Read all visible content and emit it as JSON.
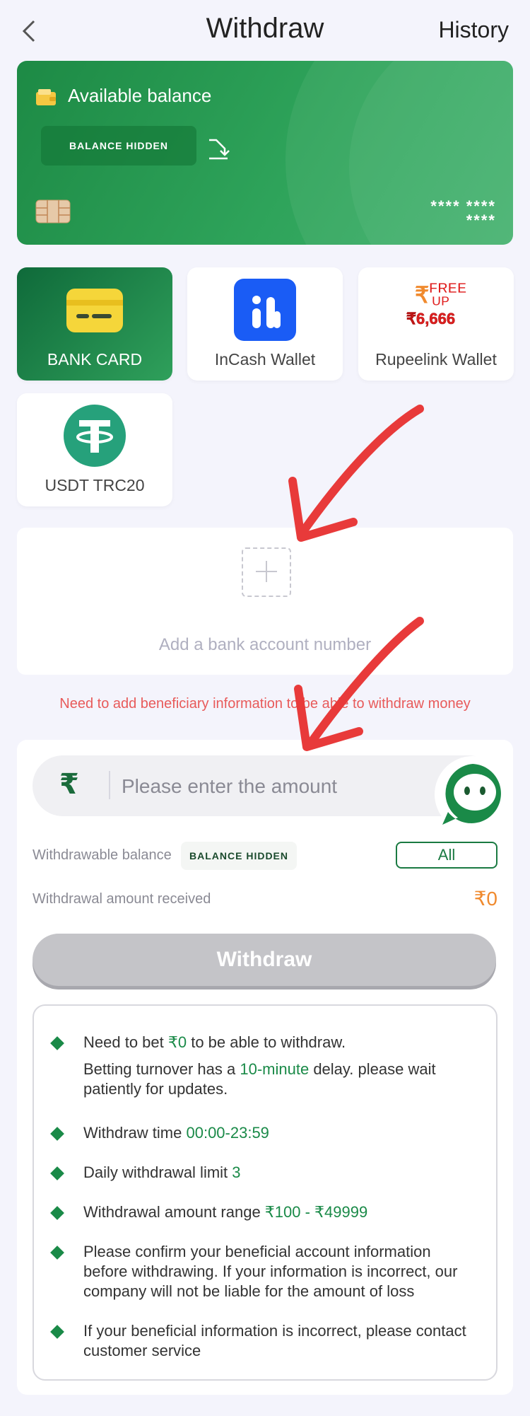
{
  "header": {
    "title": "Withdraw",
    "history_label": "History"
  },
  "balance_card": {
    "label": "Available balance",
    "balance_status": "BALANCE HIDDEN",
    "card_mask_line1": "**** ****",
    "card_mask_line2": "****"
  },
  "methods": [
    {
      "label": "BANK CARD",
      "active": true
    },
    {
      "label": "InCash Wallet",
      "active": false
    },
    {
      "label": "Rupeelink Wallet",
      "active": false,
      "promo_line1": "FREE",
      "promo_line2": "UP",
      "promo_amount": "₹6,666"
    },
    {
      "label": "USDT TRC20",
      "active": false
    }
  ],
  "add_account": {
    "label": "Add a bank account number"
  },
  "warning": {
    "text": "Need to add beneficiary information to be able to withdraw money"
  },
  "amount": {
    "currency_symbol": "₹",
    "placeholder": "Please enter the amount"
  },
  "withdrawable": {
    "label": "Withdrawable balance",
    "status": "BALANCE HIDDEN",
    "all_label": "All"
  },
  "received": {
    "label": "Withdrawal amount received",
    "value": "₹0"
  },
  "withdraw_button": {
    "label": "Withdraw"
  },
  "rules": {
    "r1_pre": "Need to bet ",
    "r1_hl": "₹0",
    "r1_post": " to be able to withdraw.",
    "r1b_pre": "Betting turnover has a ",
    "r1b_hl": "10-minute",
    "r1b_post": " delay. please wait patiently for updates.",
    "r2_pre": "Withdraw time ",
    "r2_hl": "00:00-23:59",
    "r3_pre": "Daily withdrawal limit ",
    "r3_hl": "3",
    "r4_pre": "Withdrawal amount range ",
    "r4_hl": "₹100 - ₹49999",
    "r5": "Please confirm your beneficial account information before withdrawing. If your information is incorrect, our company will not be liable for the amount of loss",
    "r6": "If your beneficial information is incorrect, please contact customer service"
  },
  "colors": {
    "primary": "#1a8a48",
    "warning": "#e85a5a",
    "amount": "#f08a2e",
    "background": "#f4f4fc"
  },
  "icons": {
    "back": "chevron-left-icon",
    "wallet": "wallet-icon",
    "refresh": "refresh-icon",
    "chip": "card-chip-icon",
    "bank_card": "bank-card-icon",
    "incash": "incash-logo-icon",
    "rupeelink": "rupeelink-promo-icon",
    "usdt": "tether-icon",
    "add": "plus-icon",
    "support": "customer-service-icon"
  }
}
